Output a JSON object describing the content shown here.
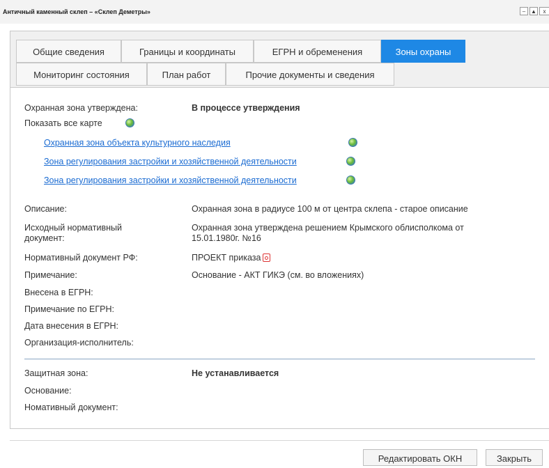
{
  "window": {
    "title": "Античный каменный склеп – «Склеп Деметры»",
    "minimize_label": "–",
    "maximize_label": "▲",
    "extra_label": "x"
  },
  "tabs": [
    {
      "label": "Общие сведения",
      "active": false
    },
    {
      "label": "Границы и координаты",
      "active": false
    },
    {
      "label": "ЕГРН и обременения",
      "active": false
    },
    {
      "label": "Зоны охраны",
      "active": true
    },
    {
      "label": "Мониторинг состояния",
      "active": false
    },
    {
      "label": "План работ",
      "active": false
    },
    {
      "label": "Прочие документы и сведения",
      "active": false
    }
  ],
  "zone": {
    "approved_label": "Охранная зона утверждена:",
    "approved_value": "В процессе утверждения",
    "show_all_label": "Показать все карте",
    "links": [
      "Охранная зона объекта культурного наследия",
      "Зона регулирования застройки и хозяйственной деятельности",
      "Зона регулирования застройки и хозяйственной деятельности"
    ]
  },
  "details": {
    "description_label": "Описание:",
    "description_value": "Охранная зона в радиусе 100 м от центра склепа - старое описание",
    "source_doc_label_1": "Исходный нормативный",
    "source_doc_label_2": "документ:",
    "source_doc_value_1": "Охранная зона утверждена решением Крымского облисполкома от",
    "source_doc_value_2": "15.01.1980г. №16",
    "rf_doc_label": "Нормативный документ РФ:",
    "rf_doc_value": "ПРОЕКТ приказа",
    "note_label": "Примечание:",
    "note_value": "Основание - АКТ ГИКЭ (см. во вложениях)",
    "egrn_label": "Внесена в ЕГРН:",
    "egrn_note_label": "Примечание по ЕГРН:",
    "egrn_date_label": "Дата внесения в ЕГРН:",
    "org_label": "Организация-исполнитель:"
  },
  "protect": {
    "zone_label": "Защитная зона:",
    "zone_value": "Не устанавливается",
    "basis_label": "Основание:",
    "doc_label": "Номативный документ:"
  },
  "footer": {
    "edit_label": "Редактировать ОКН",
    "close_label": "Закрыть"
  },
  "colors": {
    "active_tab": "#1e88e5",
    "link": "#1a6bd2"
  }
}
